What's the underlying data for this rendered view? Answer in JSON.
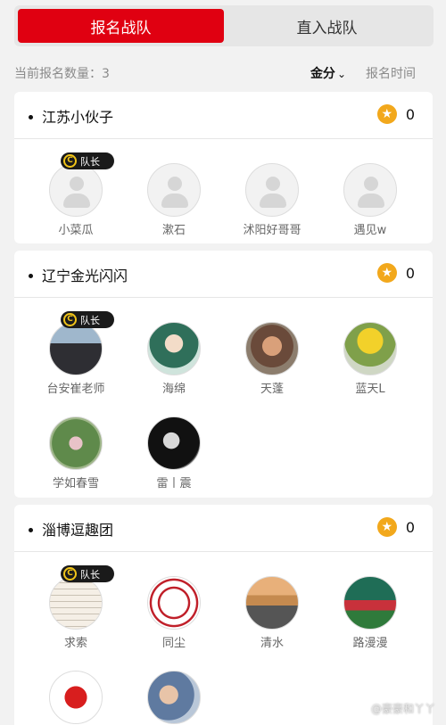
{
  "tabs": {
    "active": "报名战队",
    "inactive": "直入战队"
  },
  "summary": {
    "count_label": "当前报名数量：3",
    "sort_gold": "金分",
    "sort_time": "报名时间"
  },
  "captain_badge": "队长",
  "teams": [
    {
      "name": "江苏小伙子",
      "score": "0",
      "members": [
        {
          "name": "小菜瓜"
        },
        {
          "name": "漱石"
        },
        {
          "name": "沭阳好哥哥"
        },
        {
          "name": "遇见w"
        }
      ]
    },
    {
      "name": "辽宁金光闪闪",
      "score": "0",
      "members": [
        {
          "name": "台安崔老师"
        },
        {
          "name": "海绵"
        },
        {
          "name": "天蓬"
        },
        {
          "name": "蓝天L"
        },
        {
          "name": "学如春雪"
        },
        {
          "name": "雷丨震"
        }
      ]
    },
    {
      "name": "淄博逗趣团",
      "score": "0",
      "members": [
        {
          "name": "求索"
        },
        {
          "name": "同尘"
        },
        {
          "name": "清水"
        },
        {
          "name": "路漫漫"
        },
        {
          "name": ""
        },
        {
          "name": ""
        }
      ]
    }
  ],
  "watermark": "@豪豪和丫丫",
  "colors": {
    "accent": "#e00011",
    "star": "#f2a81c",
    "captain_bg": "#1a1a1a"
  }
}
